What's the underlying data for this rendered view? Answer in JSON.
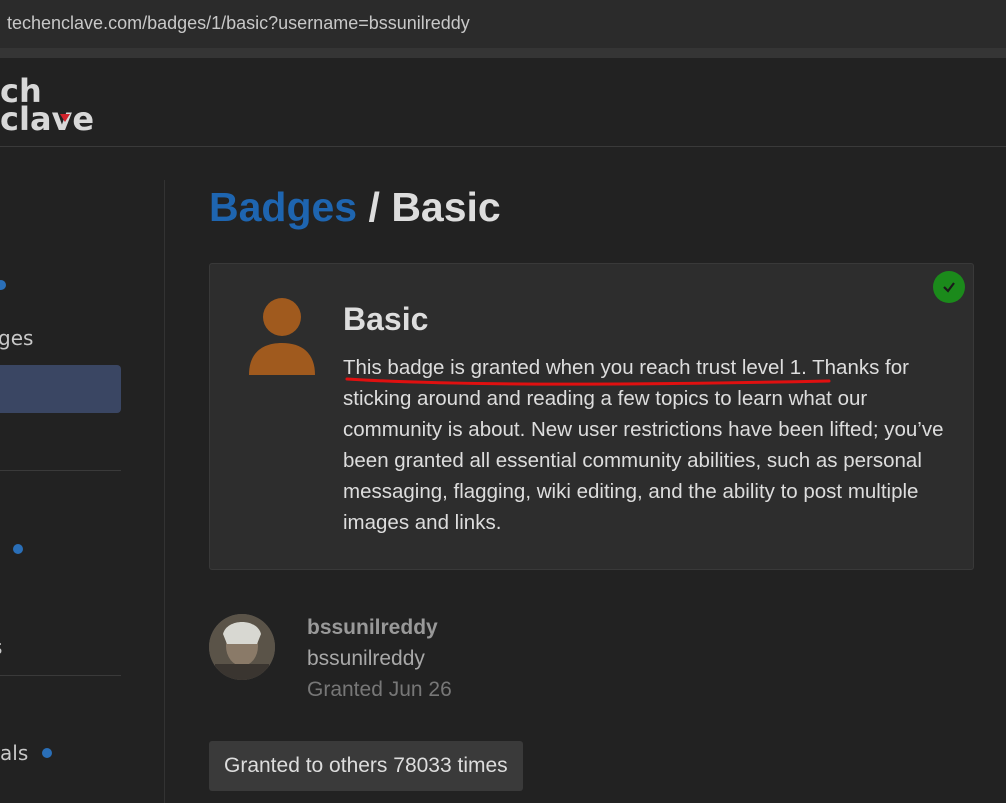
{
  "browser": {
    "url": "techenclave.com/badges/1/basic?username=bssunilreddy"
  },
  "header": {
    "logo_line1": "ch",
    "logo_line2": "clave"
  },
  "sidebar": {
    "items": [
      {
        "label": "ges"
      },
      {
        "label": "s"
      },
      {
        "label": "als"
      }
    ]
  },
  "breadcrumb": {
    "parent": "Badges",
    "separator": "/",
    "current": "Basic"
  },
  "badge": {
    "name": "Basic",
    "description": "This badge is granted when you reach trust level 1. Thanks for sticking around and reading a few topics to learn what our community is about. New user restrictions have been lifted; you’ve been granted all essential community abilities, such as personal messaging, flagging, wiki editing, and the ability to post multiple images and links.",
    "icon_color": "#a05a1e",
    "granted_check_color": "#1b8a1b"
  },
  "user": {
    "username_bold": "bssunilreddy",
    "username": "bssunilreddy",
    "granted": "Granted Jun 26"
  },
  "others_button": {
    "label": "Granted to others 78033 times"
  },
  "colors": {
    "accent": "#1e65b0",
    "annotation": "#e01010"
  }
}
